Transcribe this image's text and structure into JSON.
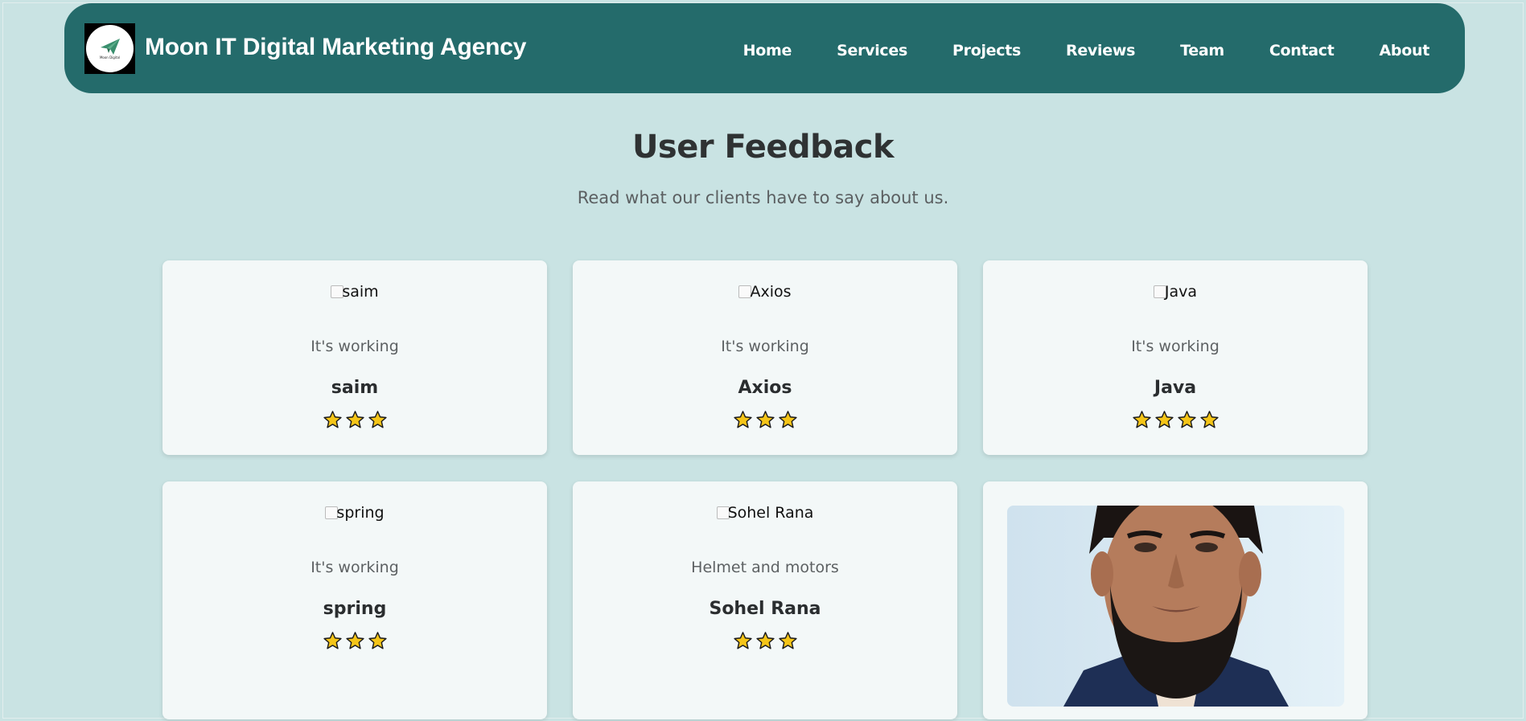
{
  "header": {
    "brand": "Moon IT Digital Marketing Agency",
    "logo_text": "Moon Digital",
    "nav": [
      "Home",
      "Services",
      "Projects",
      "Reviews",
      "Team",
      "Contact",
      "About"
    ]
  },
  "section": {
    "title": "User Feedback",
    "subtitle": "Read what our clients have to say about us."
  },
  "reviews": [
    {
      "img_alt": "saim",
      "review": "It's working",
      "name": "saim",
      "stars": 3
    },
    {
      "img_alt": "Axios",
      "review": "It's working",
      "name": "Axios",
      "stars": 3
    },
    {
      "img_alt": "Java",
      "review": "It's working",
      "name": "Java",
      "stars": 4
    },
    {
      "img_alt": "spring",
      "review": "It's working",
      "name": "spring",
      "stars": 3
    },
    {
      "img_alt": "Sohel Rana",
      "review": "Helmet and motors",
      "name": "Sohel Rana",
      "stars": 3
    }
  ],
  "colors": {
    "background": "#c9e3e3",
    "navbar": "#246b6b",
    "card": "#f3f8f8",
    "star": "#f5c518"
  },
  "icons": {
    "logo": "paper-plane-icon",
    "star": "star-icon"
  }
}
